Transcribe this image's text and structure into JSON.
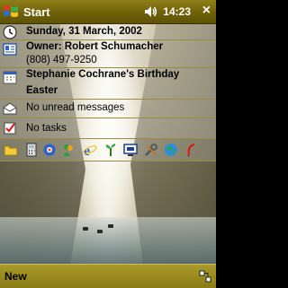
{
  "titlebar": {
    "title": "Start",
    "time": "14:23",
    "close": "×"
  },
  "today": {
    "date": "Sunday, 31 March, 2002",
    "owner": "Owner: Robert Schumacher",
    "phone": "(808) 497-9250",
    "events": [
      "Stephanie Cochrane's Birthday",
      "Easter"
    ],
    "messages": "No unread messages",
    "tasks": "No tasks"
  },
  "quick_launch_icons": [
    "contacts-folder-icon",
    "calculator-icon",
    "network-icon",
    "msn-messenger-icon",
    "internet-explorer-icon",
    "plant-icon",
    "monitor-icon",
    "tools-icon",
    "globe-icon",
    "pen-icon"
  ],
  "bottombar": {
    "new_label": "New"
  },
  "colors": {
    "titlebar": "#7a6b10",
    "bottombar": "#9a8b20",
    "divider": "#9a8a48"
  }
}
